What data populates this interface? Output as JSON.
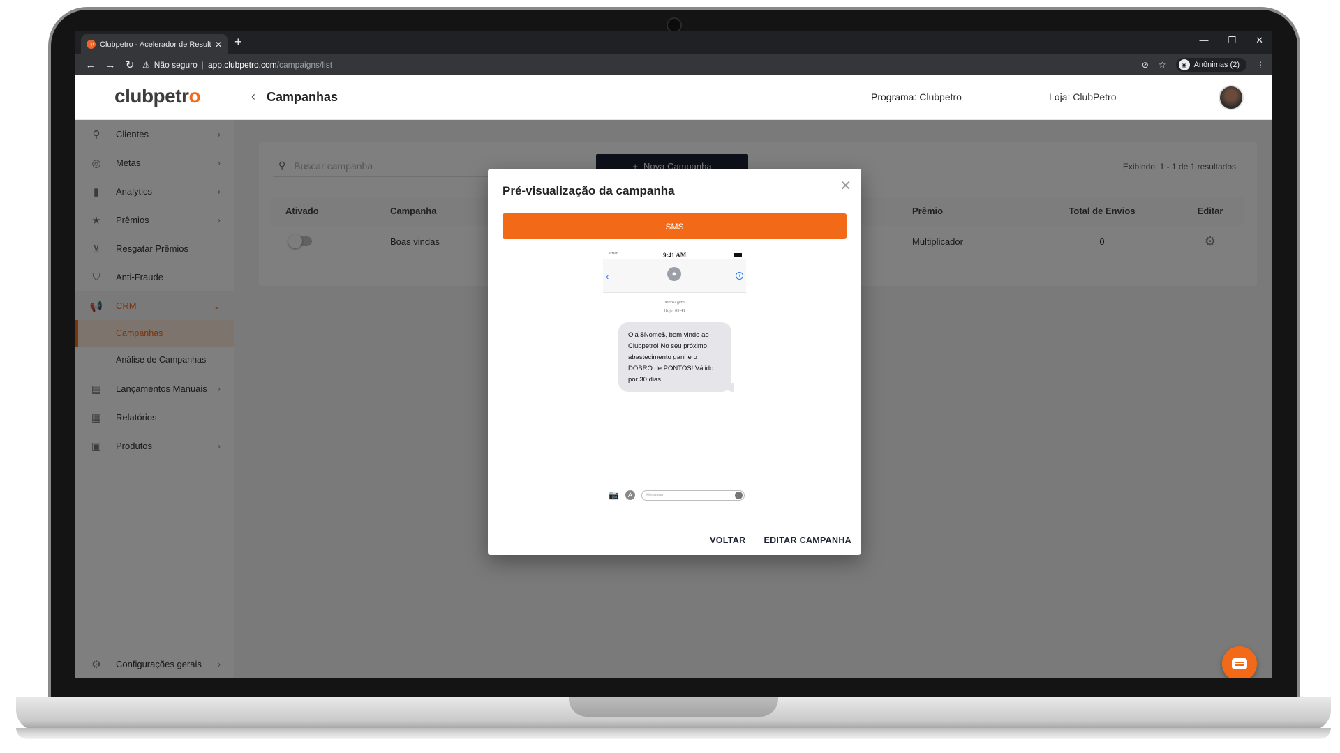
{
  "browser": {
    "tab_title": "Clubpetro - Acelerador de Result",
    "tab_favicon": "cp",
    "tab_close": "✕",
    "new_tab": "+",
    "security_label": "Não seguro",
    "url_host": "app.clubpetro.com",
    "url_path": "/campaigns/list",
    "incognito_label": "Anônimas (2)"
  },
  "app": {
    "logo_text": "clubpetr",
    "logo_accent": "o",
    "page_title": "Campanhas",
    "programa_label": "Programa:",
    "programa_value": "Clubpetro",
    "loja_label": "Loja:",
    "loja_value": "ClubPetro"
  },
  "sidebar": {
    "items": [
      {
        "label": "Clientes"
      },
      {
        "label": "Metas"
      },
      {
        "label": "Analytics"
      },
      {
        "label": "Prêmios"
      },
      {
        "label": "Resgatar Prêmios"
      },
      {
        "label": "Anti-Fraude"
      },
      {
        "label": "CRM"
      },
      {
        "label": "Lançamentos Manuais"
      },
      {
        "label": "Relatórios"
      },
      {
        "label": "Produtos"
      }
    ],
    "crm_sub": [
      {
        "label": "Campanhas"
      },
      {
        "label": "Análise de Campanhas"
      }
    ],
    "settings_label": "Configurações gerais"
  },
  "campaigns": {
    "search_placeholder": "Buscar campanha",
    "new_button": "Nova Campanha",
    "results_text": "Exibindo: 1 - 1 de 1 resultados",
    "columns": {
      "ativado": "Ativado",
      "campanha": "Campanha",
      "premio": "Prêmio",
      "total": "Total de Envios",
      "editar": "Editar"
    },
    "rows": [
      {
        "campanha": "Boas vindas",
        "premio": "Multiplicador",
        "total": "0"
      }
    ]
  },
  "modal": {
    "title": "Pré-visualização da campanha",
    "channel_tab": "SMS",
    "phone": {
      "carrier": "Carrier",
      "time": "9:41 AM",
      "meta_line1": "Mensagem",
      "meta_line2": "Hoje, 09:41",
      "message": "Olá $Nome$, bem vindo ao Clubpetro! No seu próximo abastecimento ganhe o DOBRO de PONTOS! Válido por 30 dias.",
      "input_placeholder": "Mensagem"
    },
    "back_button": "VOLTAR",
    "edit_button": "EDITAR CAMPANHA"
  },
  "colors": {
    "accent": "#f26a17",
    "dark": "#1d2332"
  }
}
